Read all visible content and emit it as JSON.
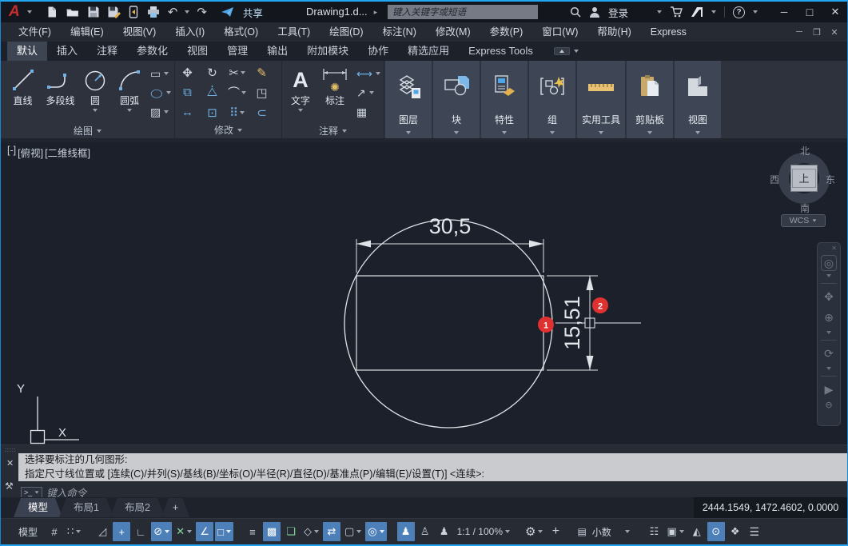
{
  "icons": {
    "dropdown": "▾",
    "flyout": "▸",
    "undo": "↶",
    "redo": "↷",
    "min": "─",
    "max": "□",
    "close": "✕",
    "restore": "❐",
    "help": "?",
    "collapse": "▴",
    "grip": ":::::",
    "wrench": "⚒",
    "prompt": ">_",
    "grid": "#",
    "snap": "∷",
    "infer": "◿",
    "dyninput": "+",
    "ortho": "∟",
    "polar": "⊘",
    "iso": "✕",
    "track": "∠",
    "osnap": "□",
    "lineweight": "≡",
    "transparency": "▩",
    "cycle": "❏",
    "osnap3d": "◇",
    "ducs": "⇄",
    "filter": "▢",
    "gizmo": "◎",
    "annovis": "♟",
    "autoscale": "♙",
    "annoscale": "♟",
    "gear": "⚙",
    "monitor": "+",
    "ruler": "▤",
    "qprops": "☷",
    "lockui": "▣",
    "isolate": "◭",
    "hwaccel": "⊙",
    "fullscreen": "❖",
    "customize": "☰",
    "wheel": "◎",
    "pan": "✥",
    "zoomx": "⊕",
    "orbit": "⟳",
    "motion": "▶",
    "navminus": "⊖",
    "move": "✥",
    "rotate": "↻",
    "trim": "✂",
    "erase": "✎",
    "copy": "⧉",
    "mirror": "⧊",
    "fillet": "⌒",
    "explode": "◳",
    "stretch": "↔",
    "scale": "⊡",
    "array": "⠿",
    "offset": "⊂",
    "rect_tool": "▭",
    "ellipse_tool": "◯",
    "hatch_tool": "▨",
    "dim_linear": "⟷",
    "leader": "↗",
    "table": "▦",
    "dim_spark": "✺",
    "group_star": "✦",
    "text_tool": "A"
  },
  "titlebar": {
    "doc_title": "Drawing1.d...",
    "share": "共享",
    "search_placeholder": "键入关键字或短语",
    "login": "登录"
  },
  "menubar": {
    "items": [
      "文件(F)",
      "编辑(E)",
      "视图(V)",
      "插入(I)",
      "格式(O)",
      "工具(T)",
      "绘图(D)",
      "标注(N)",
      "修改(M)",
      "参数(P)",
      "窗口(W)",
      "帮助(H)",
      "Express"
    ]
  },
  "ribbon": {
    "tabs": [
      "默认",
      "插入",
      "注释",
      "参数化",
      "视图",
      "管理",
      "输出",
      "附加模块",
      "协作",
      "精选应用",
      "Express Tools"
    ],
    "panels": {
      "draw": {
        "label": "绘图",
        "line": "直线",
        "polyline": "多段线",
        "circle": "圆",
        "arc": "圆弧"
      },
      "modify": {
        "label": "修改"
      },
      "annotate": {
        "label": "注释",
        "text": "文字",
        "dim": "标注"
      },
      "collapsed": [
        "图层",
        "块",
        "特性",
        "组",
        "实用工具",
        "剪贴板",
        "视图"
      ]
    }
  },
  "viewport": {
    "menu": "[-]",
    "view": "[俯视]",
    "visual": "[二维线框]",
    "viewcube": {
      "n": "北",
      "s": "南",
      "w": "西",
      "e": "东",
      "top": "上",
      "wcs": "WCS"
    }
  },
  "drawing": {
    "dim_h": "30,5",
    "dim_v": "15,51",
    "badge1": "1",
    "badge2": "2",
    "ucs_x": "X",
    "ucs_y": "Y"
  },
  "command": {
    "line1": "选择要标注的几何图形:",
    "line2": "指定尺寸线位置或 [连续(C)/并列(S)/基线(B)/坐标(O)/半径(R)/直径(D)/基准点(P)/编辑(E)/设置(T)] <连续>:",
    "placeholder": "键入命令"
  },
  "layouts": {
    "model": "模型",
    "layout1": "布局1",
    "layout2": "布局2",
    "add": "+",
    "coords": "2444.1549, 1472.4602, 0.0000"
  },
  "statusbar": {
    "model": "模型",
    "scale": "1:1 / 100%",
    "units": "小数"
  }
}
